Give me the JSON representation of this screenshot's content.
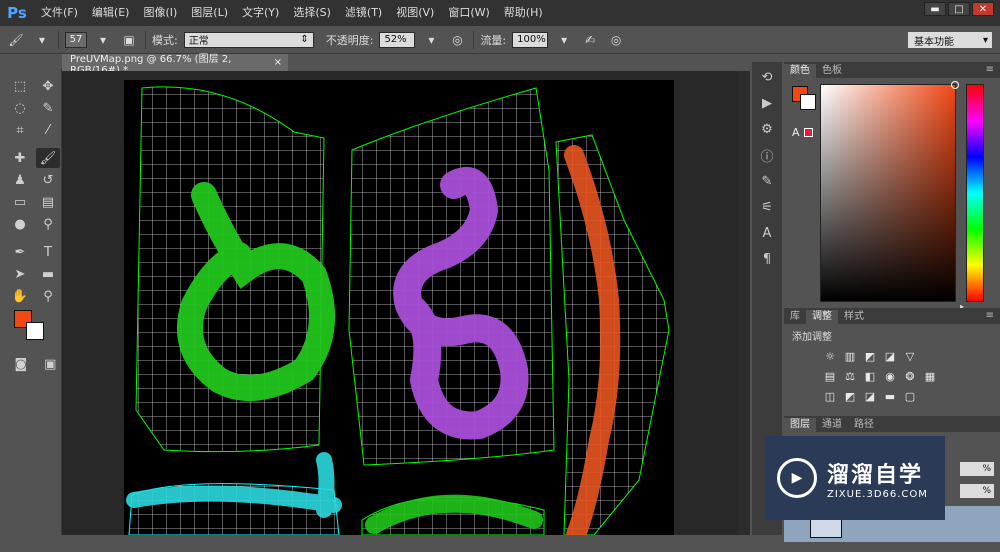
{
  "app": {
    "logo": "Ps"
  },
  "menu": [
    "文件(F)",
    "编辑(E)",
    "图像(I)",
    "图层(L)",
    "文字(Y)",
    "选择(S)",
    "滤镜(T)",
    "视图(V)",
    "窗口(W)",
    "帮助(H)"
  ],
  "window_controls": {
    "minimize": "▬",
    "restore": "□",
    "close": "✕"
  },
  "options": {
    "brush_size": "57",
    "mode_label": "模式:",
    "mode_value": "正常",
    "opacity_label": "不透明度:",
    "opacity_value": "52%",
    "flow_label": "流量:",
    "flow_value": "100%",
    "workspace": "基本功能"
  },
  "document_tab": {
    "title": "PreUVMap.png @ 66.7% (图层 2, RGB/16#) *",
    "close": "×"
  },
  "panels": {
    "color_tabs": [
      "颜色",
      "色板"
    ],
    "adjust_tabs": [
      "库",
      "调整",
      "样式"
    ],
    "adjust_title": "添加调整",
    "layers_tabs": [
      "图层",
      "通道",
      "路径"
    ],
    "opacity_pct": "%",
    "fill_pct": "%",
    "menu_icon": "≡"
  },
  "colors": {
    "foreground": "#f24814",
    "background": "#ffffff",
    "gamut_warning": "#e61b3a"
  },
  "watermark": {
    "title": "溜溜自学",
    "subtitle": "ZIXUE.3D66.COM"
  }
}
